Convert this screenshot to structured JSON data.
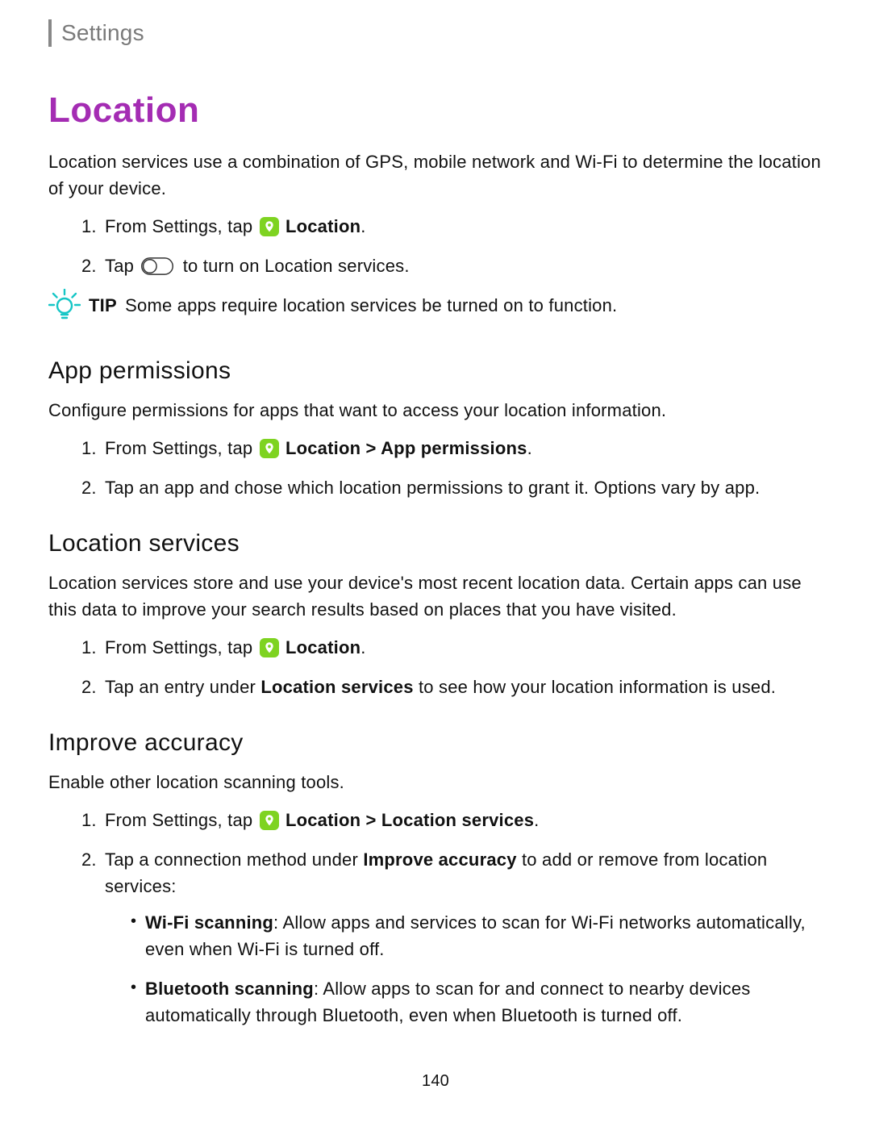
{
  "header": {
    "section": "Settings"
  },
  "title": "Location",
  "intro": "Location services use a combination of GPS, mobile network and Wi-Fi to determine the location of your device.",
  "steps_intro": {
    "s1_prefix": "From Settings, tap ",
    "s1_bold": "Location",
    "s1_suffix": ".",
    "s2_prefix": "Tap ",
    "s2_suffix": " to turn on Location services."
  },
  "tip": {
    "label": "TIP",
    "text": "Some apps require location services be turned on to function."
  },
  "app_perm": {
    "heading": "App permissions",
    "desc": "Configure permissions for apps that want to access your location information.",
    "s1_prefix": "From Settings, tap ",
    "s1_bold": "Location > App permissions",
    "s1_suffix": ".",
    "s2": "Tap an app and chose which location permissions to grant it. Options vary by app."
  },
  "loc_services": {
    "heading": "Location services",
    "desc": "Location services store and use your device's most recent location data. Certain apps can use this data to improve your search results based on places that you have visited.",
    "s1_prefix": "From Settings, tap ",
    "s1_bold": "Location",
    "s1_suffix": ".",
    "s2_pre": "Tap an entry under ",
    "s2_bold": "Location services",
    "s2_post": " to see how your location information is used."
  },
  "improve": {
    "heading": "Improve accuracy",
    "desc": "Enable other location scanning tools.",
    "s1_prefix": "From Settings, tap ",
    "s1_bold": "Location > Location services",
    "s1_suffix": ".",
    "s2_pre": "Tap a connection method under ",
    "s2_bold": "Improve accuracy",
    "s2_post": " to add or remove from location services:",
    "wifi_label": "Wi-Fi scanning",
    "wifi_text": ": Allow apps and services to scan for Wi-Fi networks automatically, even when Wi-Fi is turned off.",
    "bt_label": "Bluetooth scanning",
    "bt_text": ": Allow apps to scan for and connect to nearby devices automatically through Bluetooth, even when Bluetooth is turned off."
  },
  "page_number": "140"
}
